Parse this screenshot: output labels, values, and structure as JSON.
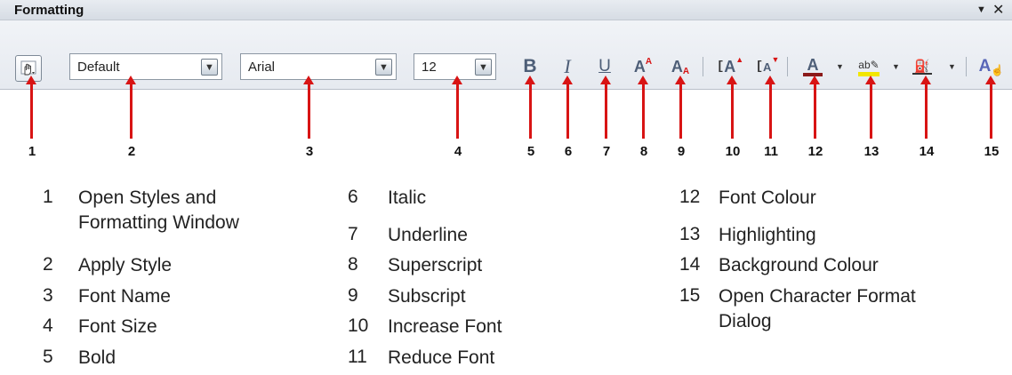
{
  "toolbar": {
    "title": "Formatting",
    "menu_icon": "triangle-down-icon",
    "close_icon": "close-icon",
    "apply_style_value": "Default",
    "font_name_value": "Arial",
    "font_size_value": "12",
    "accent_red": "#d81414",
    "font_colour": "#8b1a1a",
    "highlight_colour": "#f2e600"
  },
  "callouts": [
    "1",
    "2",
    "3",
    "4",
    "5",
    "6",
    "7",
    "8",
    "9",
    "10",
    "11",
    "12",
    "13",
    "14",
    "15"
  ],
  "legend": {
    "col1": [
      {
        "num": "1",
        "text": "Open Styles and",
        "text2": "Formatting Window"
      },
      {
        "num": "2",
        "text": "Apply Style"
      },
      {
        "num": "3",
        "text": "Font Name"
      },
      {
        "num": "4",
        "text": "Font Size"
      },
      {
        "num": "5",
        "text": "Bold"
      }
    ],
    "col2": [
      {
        "num": "6",
        "text": "Italic"
      },
      {
        "num": "7",
        "text": "Underline"
      },
      {
        "num": "8",
        "text": "Superscript"
      },
      {
        "num": "9",
        "text": "Subscript"
      },
      {
        "num": "10",
        "text": "Increase Font"
      },
      {
        "num": "11",
        "text": "Reduce Font"
      }
    ],
    "col3": [
      {
        "num": "12",
        "text": "Font Colour"
      },
      {
        "num": "13",
        "text": "Highlighting"
      },
      {
        "num": "14",
        "text": "Background Colour"
      },
      {
        "num": "15",
        "text": "Open Character Format",
        "text2": "Dialog"
      }
    ]
  }
}
